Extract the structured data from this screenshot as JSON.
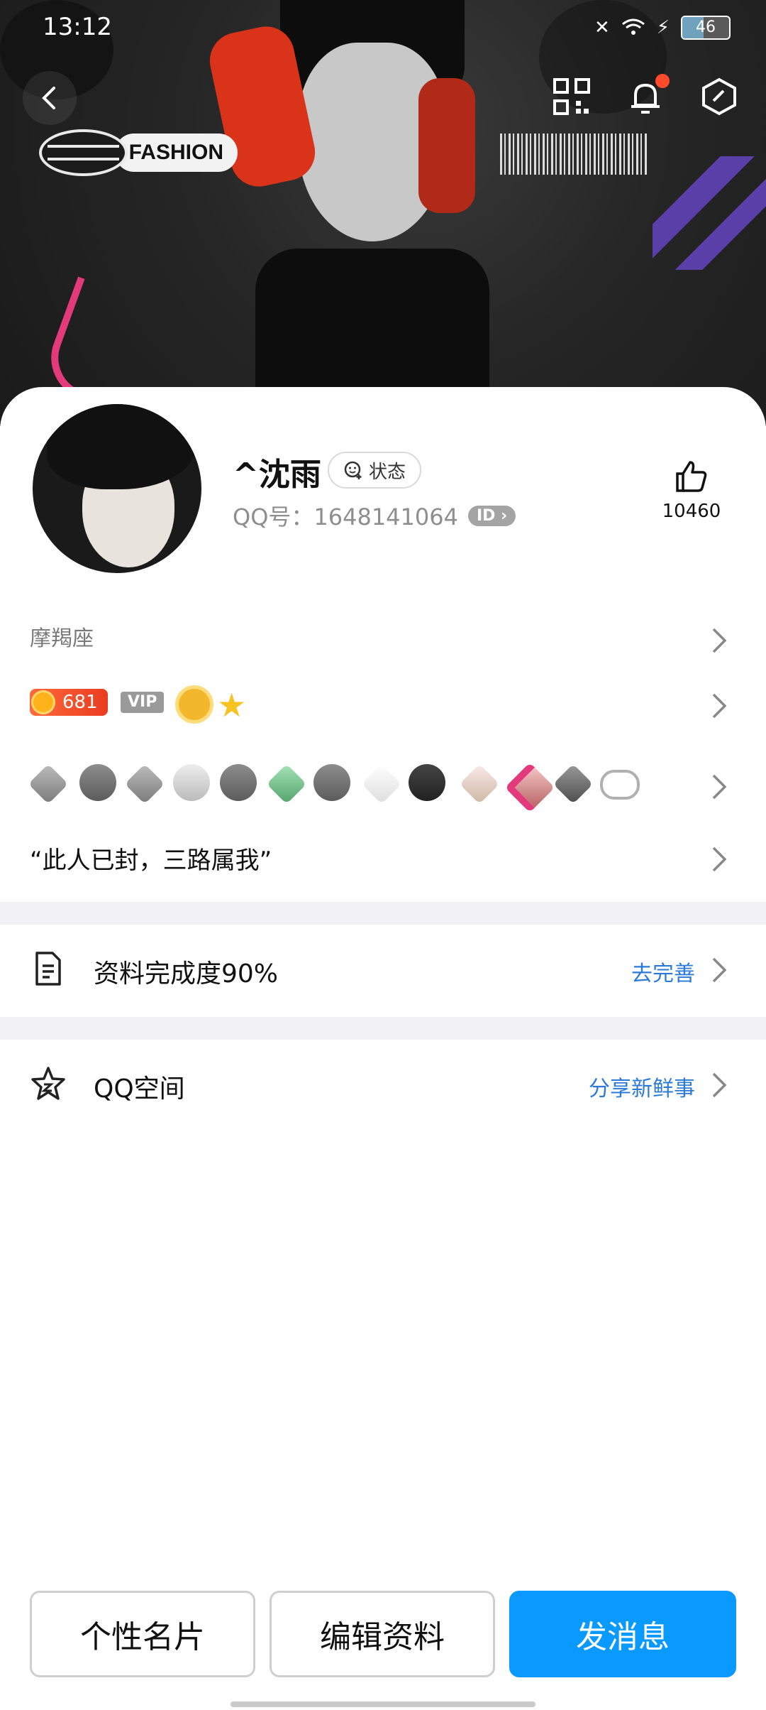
{
  "status_bar": {
    "time": "13:12",
    "battery": "46",
    "battery_level": 0.46
  },
  "banner": {
    "logo_text": "FASHION"
  },
  "profile": {
    "nickname": "^沈雨",
    "status_label": "状态",
    "qq_label": "QQ号：1648141064",
    "id_badge": "ID",
    "like_count": "10460",
    "zodiac": "摩羯座",
    "level": "681",
    "vip": "VIP",
    "signature": "“此人已封，三路属我”"
  },
  "rows": {
    "profile_completion": {
      "label": "资料完成度90%",
      "action": "去完善"
    },
    "qzone": {
      "label": "QQ空间",
      "action": "分享新鲜事"
    }
  },
  "bottom_buttons": {
    "card": "个性名片",
    "edit": "编辑资料",
    "message": "发消息"
  },
  "colors": {
    "accent": "#0a99ff",
    "link": "#2b7bd6",
    "notification": "#ff4b2b"
  }
}
